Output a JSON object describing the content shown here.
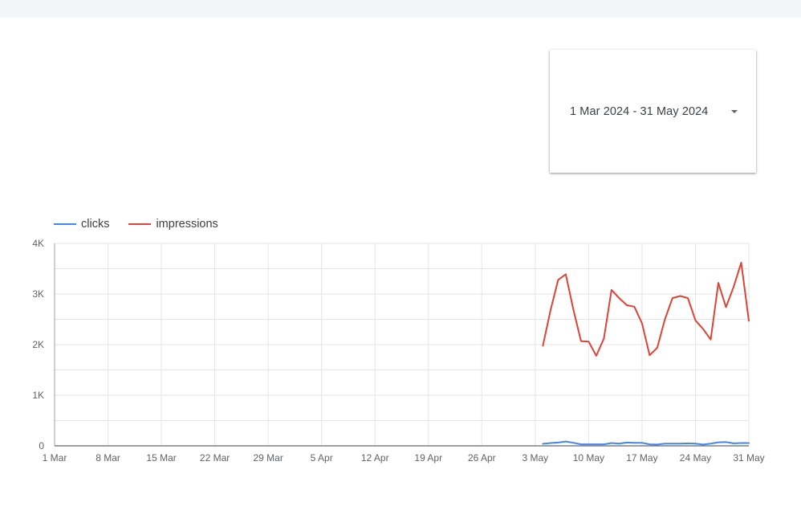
{
  "date_range": {
    "label": "1 Mar 2024 - 31 May 2024",
    "icon": "arrow-drop-down-icon"
  },
  "colors": {
    "clicks": "#4285f4",
    "impressions": "#db4437",
    "grid": "#e6e6e6",
    "axis": "#5f6368"
  },
  "chart_data": {
    "type": "line",
    "legend_position": "top-left",
    "grid": true,
    "x_ticks": [
      "1 Mar",
      "8 Mar",
      "15 Mar",
      "22 Mar",
      "29 Mar",
      "5 Apr",
      "12 Apr",
      "19 Apr",
      "26 Apr",
      "3 May",
      "10 May",
      "17 May",
      "24 May",
      "31 May"
    ],
    "y_ticks": [
      "0",
      "1K",
      "2K",
      "3K",
      "4K"
    ],
    "ylim": [
      0,
      4000
    ],
    "x_range": [
      "2024-03-01",
      "2024-05-31"
    ],
    "x": [
      "2024-05-04",
      "2024-05-05",
      "2024-05-06",
      "2024-05-07",
      "2024-05-08",
      "2024-05-09",
      "2024-05-10",
      "2024-05-11",
      "2024-05-12",
      "2024-05-13",
      "2024-05-14",
      "2024-05-15",
      "2024-05-16",
      "2024-05-17",
      "2024-05-18",
      "2024-05-19",
      "2024-05-20",
      "2024-05-21",
      "2024-05-22",
      "2024-05-23",
      "2024-05-24",
      "2024-05-25",
      "2024-05-26",
      "2024-05-27",
      "2024-05-28",
      "2024-05-29",
      "2024-05-30",
      "2024-05-31"
    ],
    "series": [
      {
        "name": "clicks",
        "values": [
          40,
          55,
          65,
          85,
          60,
          30,
          30,
          30,
          30,
          55,
          45,
          65,
          60,
          60,
          30,
          25,
          45,
          45,
          45,
          50,
          45,
          25,
          45,
          70,
          75,
          50,
          55,
          55
        ]
      },
      {
        "name": "impressions",
        "values": [
          1980,
          2680,
          3280,
          3390,
          2690,
          2070,
          2060,
          1780,
          2120,
          3080,
          2920,
          2780,
          2750,
          2420,
          1790,
          1940,
          2500,
          2920,
          2960,
          2920,
          2480,
          2310,
          2100,
          3220,
          2740,
          3140,
          3620,
          2470
        ]
      }
    ]
  }
}
